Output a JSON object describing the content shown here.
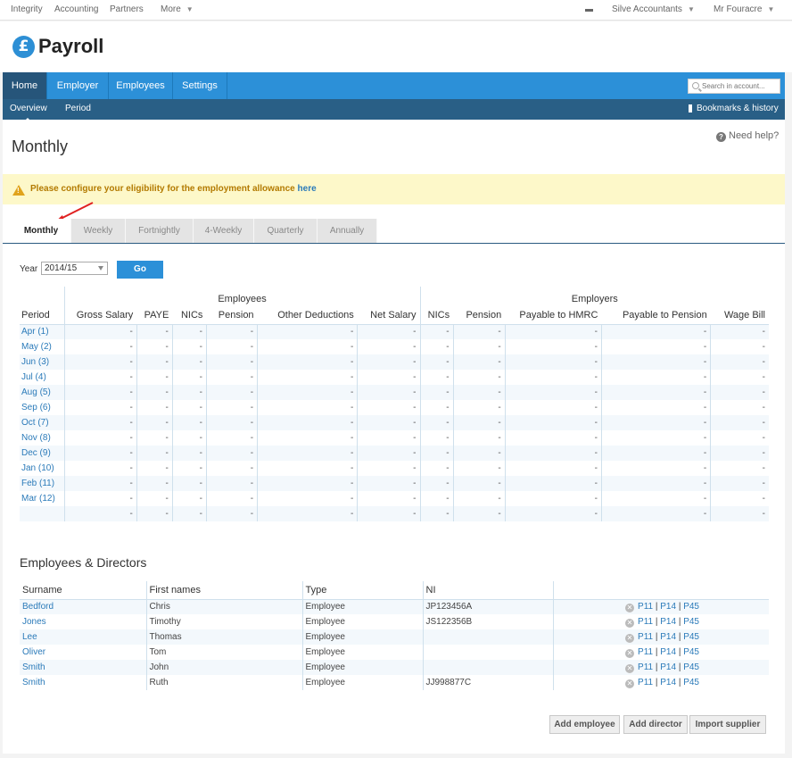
{
  "topbar": {
    "links": [
      "Integrity",
      "Accounting",
      "Partners"
    ],
    "more": "More",
    "company": "Silve Accountants",
    "user": "Mr Fouracre"
  },
  "logo": {
    "symbol": "£",
    "text": "Payroll",
    "color": "#2d8fd5"
  },
  "nav": {
    "tabs": [
      "Home",
      "Employer",
      "Employees",
      "Settings"
    ],
    "active": "Home",
    "search_placeholder": "Search in account..."
  },
  "subnav": {
    "items": [
      "Overview",
      "Period"
    ],
    "active": "Overview",
    "bookmarks": "Bookmarks & history"
  },
  "page": {
    "title": "Monthly",
    "help": "Need help?"
  },
  "alert": {
    "text": "Please configure your eligibility for the employment allowance",
    "link": "here"
  },
  "period_tabs": [
    "Monthly",
    "Weekly",
    "Fortnightly",
    "4-Weekly",
    "Quarterly",
    "Annually"
  ],
  "year": {
    "label": "Year",
    "value": "2014/15",
    "go": "Go"
  },
  "summary": {
    "group_employees": "Employees",
    "group_employers": "Employers",
    "columns": [
      "Period",
      "Gross Salary",
      "PAYE",
      "NICs",
      "Pension",
      "Other Deductions",
      "Net Salary",
      "NICs",
      "Pension",
      "Payable to HMRC",
      "Payable to Pension",
      "Wage Bill"
    ],
    "periods": [
      "Apr (1)",
      "May (2)",
      "Jun (3)",
      "Jul (4)",
      "Aug (5)",
      "Sep (6)",
      "Oct (7)",
      "Nov (8)",
      "Dec (9)",
      "Jan (10)",
      "Feb (11)",
      "Mar (12)",
      ""
    ],
    "empty_value": "-"
  },
  "employees": {
    "title": "Employees & Directors",
    "columns": [
      "Surname",
      "First names",
      "Type",
      "NI"
    ],
    "rows": [
      {
        "surname": "Bedford",
        "first": "Chris",
        "type": "Employee",
        "ni": "JP123456A"
      },
      {
        "surname": "Jones",
        "first": "Timothy",
        "type": "Employee",
        "ni": "JS122356B"
      },
      {
        "surname": "Lee",
        "first": "Thomas",
        "type": "Employee",
        "ni": ""
      },
      {
        "surname": "Oliver",
        "first": "Tom",
        "type": "Employee",
        "ni": ""
      },
      {
        "surname": "Smith",
        "first": "John",
        "type": "Employee",
        "ni": ""
      },
      {
        "surname": "Smith",
        "first": "Ruth",
        "type": "Employee",
        "ni": "JJ998877C"
      }
    ],
    "action_links": [
      "P11",
      "P14",
      "P45"
    ],
    "buttons": [
      "Add employee",
      "Add director",
      "Import supplier"
    ]
  }
}
